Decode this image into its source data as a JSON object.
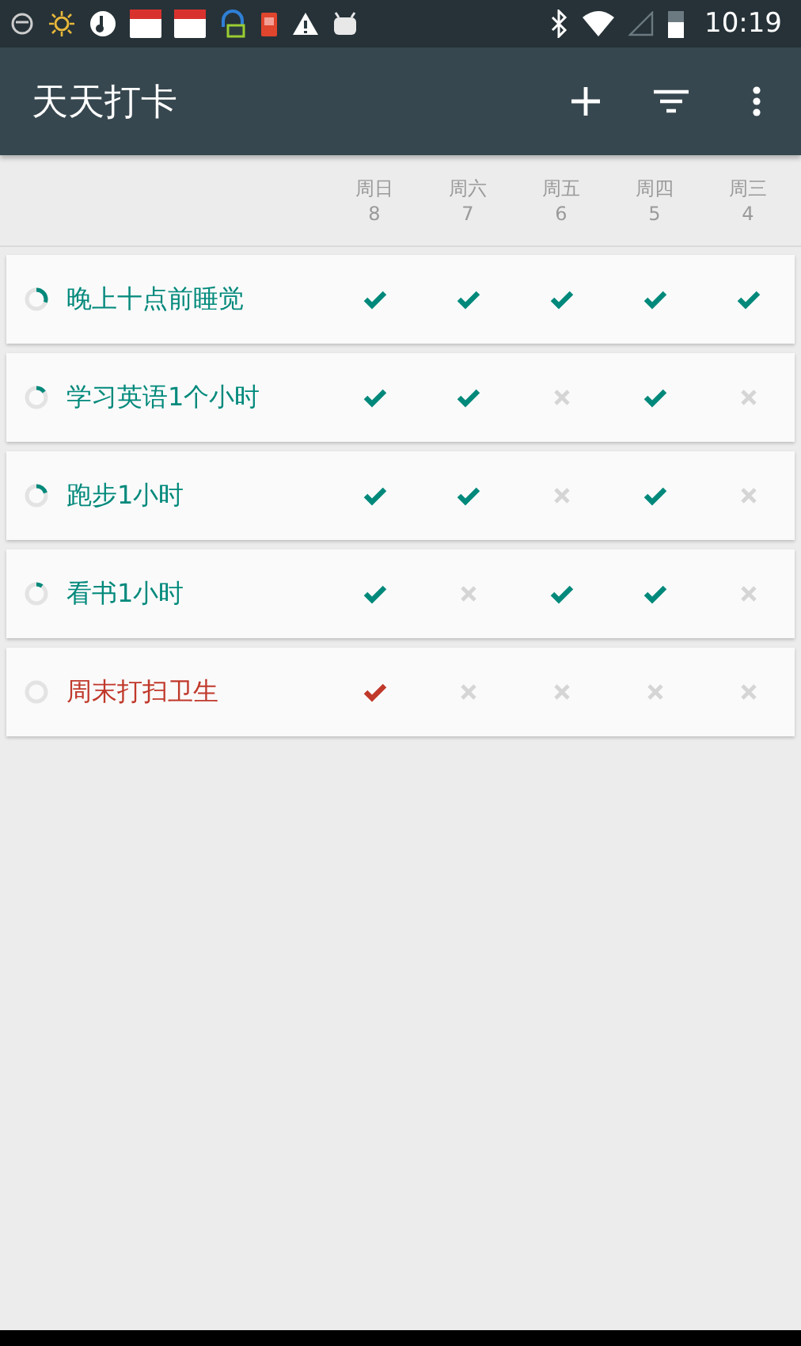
{
  "status_bar": {
    "time": "10:19"
  },
  "app_bar": {
    "title": "天天打卡"
  },
  "days": [
    {
      "weekday": "周日",
      "date": "8"
    },
    {
      "weekday": "周六",
      "date": "7"
    },
    {
      "weekday": "周五",
      "date": "6"
    },
    {
      "weekday": "周四",
      "date": "5"
    },
    {
      "weekday": "周三",
      "date": "4"
    }
  ],
  "habits": [
    {
      "name": "晚上十点前睡觉",
      "color": "#00897b",
      "level": 0.3,
      "checks": [
        true,
        true,
        true,
        true,
        true
      ]
    },
    {
      "name": "学习英语1个小时",
      "color": "#00897b",
      "level": 0.15,
      "checks": [
        true,
        true,
        false,
        true,
        false
      ]
    },
    {
      "name": "跑步1小时",
      "color": "#00897b",
      "level": 0.2,
      "checks": [
        true,
        true,
        false,
        true,
        false
      ]
    },
    {
      "name": "看书1小时",
      "color": "#00897b",
      "level": 0.1,
      "checks": [
        true,
        false,
        true,
        true,
        false
      ]
    },
    {
      "name": "周末打扫卫生",
      "color": "#c0392b",
      "level": 0,
      "checks": [
        true,
        false,
        false,
        false,
        false
      ]
    }
  ]
}
